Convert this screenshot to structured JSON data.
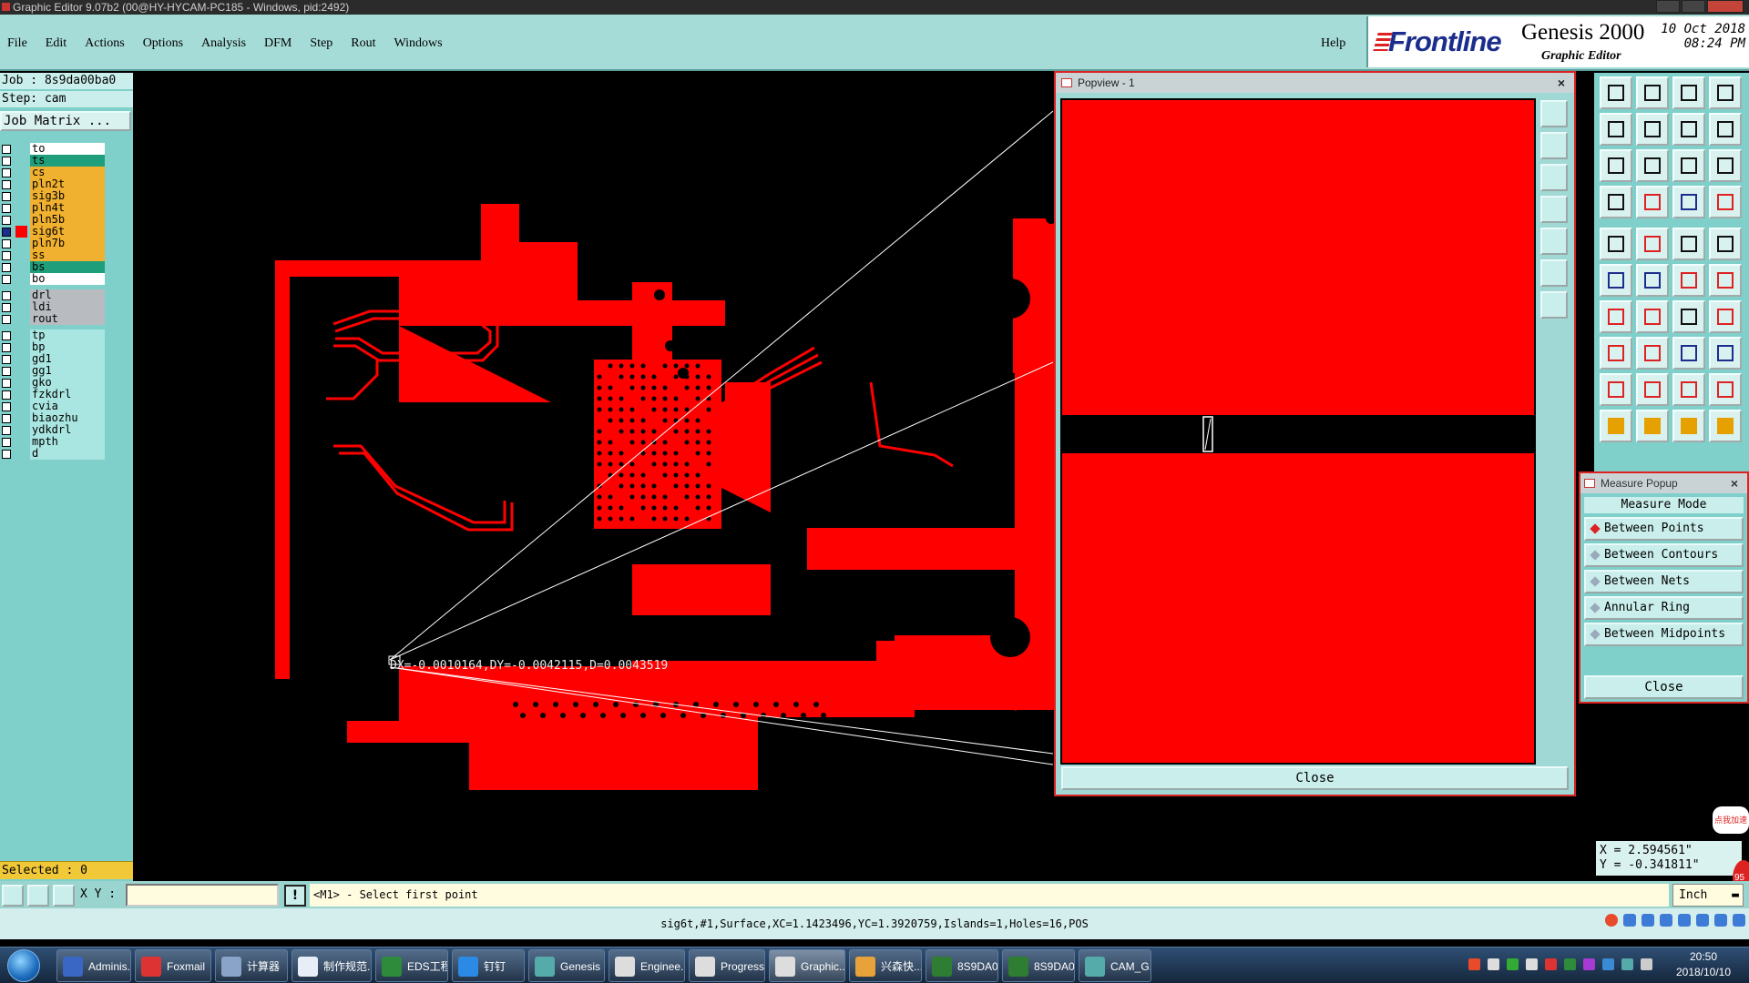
{
  "window": {
    "title": "Graphic Editor 9.07b2 (00@HY-HYCAM-PC185 - Windows, pid:2492)"
  },
  "menu": {
    "items": [
      "File",
      "Edit",
      "Actions",
      "Options",
      "Analysis",
      "DFM",
      "Step",
      "Rout",
      "Windows"
    ],
    "help": "Help"
  },
  "brand": {
    "logo": "Frontline",
    "product": "Genesis 2000",
    "subtitle": "Graphic Editor",
    "date": "10 Oct 2018",
    "time": "08:24 PM"
  },
  "job": {
    "job_label": "Job : 8s9da00ba0",
    "step_label": "Step: cam",
    "matrix_button": "Job Matrix ..."
  },
  "layers": [
    {
      "name": "to",
      "color": "#ffffff",
      "mark": "◆"
    },
    {
      "name": "ts",
      "color": "#1e9e7a",
      "mark": ""
    },
    {
      "name": "cs",
      "color": "#f0b030",
      "mark": "◆"
    },
    {
      "name": "pln2t",
      "color": "#f0b030",
      "mark": ""
    },
    {
      "name": "sig3b",
      "color": "#f0b030",
      "mark": "◆"
    },
    {
      "name": "pln4t",
      "color": "#f0b030",
      "mark": ""
    },
    {
      "name": "pln5b",
      "color": "#f0b030",
      "mark": ""
    },
    {
      "name": "sig6t",
      "color": "#f0b030",
      "mark": "◆■",
      "active": true
    },
    {
      "name": "pln7b",
      "color": "#f0b030",
      "mark": ""
    },
    {
      "name": "ss",
      "color": "#f0b030",
      "mark": "◆"
    },
    {
      "name": "bs",
      "color": "#1e9e7a",
      "mark": ""
    },
    {
      "name": "bo",
      "color": "#ffffff",
      "mark": ""
    },
    {
      "name": "drl",
      "color": "#b8bcc0",
      "mark": ""
    },
    {
      "name": "ldi",
      "color": "#b8bcc0",
      "mark": ""
    },
    {
      "name": "rout",
      "color": "#b8bcc0",
      "mark": ""
    },
    {
      "name": "tp",
      "color": "#a9e6e1",
      "mark": ""
    },
    {
      "name": "bp",
      "color": "#a9e6e1",
      "mark": ""
    },
    {
      "name": "gd1",
      "color": "#a9e6e1",
      "mark": "◆"
    },
    {
      "name": "gg1",
      "color": "#a9e6e1",
      "mark": ""
    },
    {
      "name": "gko",
      "color": "#a9e6e1",
      "mark": "◆"
    },
    {
      "name": "fzkdrl",
      "color": "#a9e6e1",
      "mark": ""
    },
    {
      "name": "cvia",
      "color": "#a9e6e1",
      "mark": ""
    },
    {
      "name": "biaozhu",
      "color": "#a9e6e1",
      "mark": ""
    },
    {
      "name": "ydkdrl",
      "color": "#a9e6e1",
      "mark": ""
    },
    {
      "name": "mpth",
      "color": "#a9e6e1",
      "mark": ""
    },
    {
      "name": "d",
      "color": "#a9e6e1",
      "mark": ""
    }
  ],
  "selected_label": "Selected : 0",
  "measure_readout": "DX=-0.0010164,DY=-0.0042115,D=0.0043519",
  "popview": {
    "title": "Popview - 1",
    "close_label": "Close"
  },
  "measure_popup": {
    "title": "Measure Popup",
    "mode_label": "Measure Mode",
    "options": [
      "Between Points",
      "Between Contours",
      "Between Nets",
      "Annular Ring",
      "Between Midpoints"
    ],
    "selected_index": 0,
    "close_label": "Close"
  },
  "coords": {
    "x": "X = 2.594561\"",
    "y": "Y = -0.341811\""
  },
  "balloon_text": "点我加速",
  "badge_number": "95",
  "command": {
    "xy_label": "X Y :",
    "xy_value": "",
    "prompt": "<M1> - Select first point",
    "units": "Inch"
  },
  "status": "sig6t,#1,Surface,XC=1.1423496,YC=1.3920759,Islands=1,Holes=16,POS",
  "taskbar": {
    "tasks": [
      {
        "label": "Adminis...",
        "color": "#3a66c4"
      },
      {
        "label": "Foxmail",
        "color": "#d33"
      },
      {
        "label": "计算器",
        "color": "#8aa3c8"
      },
      {
        "label": "制作规范...",
        "color": "#e8eef8"
      },
      {
        "label": "EDS工程...",
        "color": "#2e8b3b"
      },
      {
        "label": "钉钉",
        "color": "#2b8ae6"
      },
      {
        "label": "Genesis",
        "color": "#5aa"
      },
      {
        "label": "Enginee...",
        "color": "#ddd"
      },
      {
        "label": "Progress",
        "color": "#ddd"
      },
      {
        "label": "Graphic...",
        "color": "#ddd",
        "active": true
      },
      {
        "label": "兴森快...",
        "color": "#e8a23a"
      },
      {
        "label": "8S9DA0...",
        "color": "#2e7d32"
      },
      {
        "label": "8S9DA0...",
        "color": "#2e7d32"
      },
      {
        "label": "CAM_G...",
        "color": "#5aa"
      }
    ],
    "clock_time": "20:50",
    "clock_date": "2018/10/10"
  }
}
